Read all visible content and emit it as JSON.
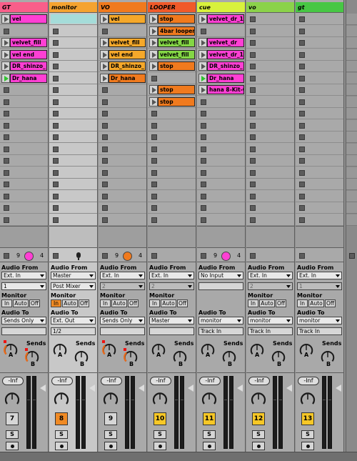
{
  "tracks": [
    {
      "id": "t1",
      "name": "GT",
      "color": "#f95e8a",
      "clips": [
        {
          "name": "vel",
          "color": "#ff3fd4"
        },
        null,
        {
          "name": "velvet_fill",
          "color": "#ff3fd4"
        },
        {
          "name": "vel end",
          "color": "#ff3fd4"
        },
        {
          "name": "DR_shinzo_",
          "color": "#ff3fd4"
        },
        {
          "name": "Dr_hana",
          "color": "#ff3fd4",
          "playing": true
        },
        null,
        null,
        null,
        null,
        null,
        null,
        null,
        null,
        null,
        null,
        null,
        null
      ],
      "counters": [
        "9",
        "4"
      ],
      "indicator": "dot",
      "indicator_color": "#ff3fd4",
      "audio_from_label": "Audio From",
      "audio_from": "Ext. In",
      "channel": "1",
      "channel_dim": false,
      "monitor_label": "Monitor",
      "monitor": [
        "In",
        "Auto",
        "Off"
      ],
      "monitor_on": null,
      "audio_to_label": "Audio To",
      "audio_to": "Sends Only",
      "audio_to_sub": "",
      "sends_label": "Sends",
      "send_a": "A",
      "send_b": "B",
      "send_red": true,
      "volume": "-Inf",
      "number": "7",
      "number_color": "#d6d6d6",
      "solo": "S",
      "selected": false
    },
    {
      "id": "t2",
      "name": "monitor",
      "color": "#f5a330",
      "clips": [
        "lane",
        null,
        null,
        null,
        null,
        null,
        null,
        null,
        null,
        null,
        null,
        null,
        null,
        null,
        null,
        null,
        null,
        null
      ],
      "counters": [
        "",
        ""
      ],
      "indicator": "mic",
      "indicator_color": "#222",
      "audio_from_label": "Audio From",
      "audio_from": "Master",
      "channel": "Post Mixer",
      "channel_dim": false,
      "monitor_label": "Monitor",
      "monitor": [
        "In",
        "Auto",
        "Off"
      ],
      "monitor_on": 0,
      "audio_to_label": "Audio To",
      "audio_to": "Ext. Out",
      "audio_to_sub": "1/2",
      "sends_label": "Sends",
      "send_a": "A",
      "send_b": "B",
      "send_red": false,
      "volume": "-Inf",
      "number": "8",
      "number_color": "#f08a24",
      "solo": "S",
      "selected": true
    },
    {
      "id": "t3",
      "name": "VO",
      "color": "#f07a1e",
      "clips": [
        {
          "name": "vel",
          "color": "#f5a82a"
        },
        null,
        {
          "name": "velvet_fill",
          "color": "#f5a82a"
        },
        {
          "name": "vel end",
          "color": "#f5a82a"
        },
        {
          "name": "DR_shinzo_",
          "color": "#f5a82a"
        },
        {
          "name": "Dr_hana",
          "color": "#f07a1e"
        },
        null,
        null,
        null,
        null,
        null,
        null,
        null,
        null,
        null,
        null,
        null,
        null
      ],
      "counters": [
        "9",
        "4"
      ],
      "indicator": "dot",
      "indicator_color": "#f07a1e",
      "audio_from_label": "Audio From",
      "audio_from": "Ext. In",
      "channel": "2",
      "channel_dim": true,
      "monitor_label": "Monitor",
      "monitor": [
        "In",
        "Auto",
        "Off"
      ],
      "monitor_on": null,
      "audio_to_label": "Audio To",
      "audio_to": "Sends Only",
      "audio_to_sub": "",
      "sends_label": "Sends",
      "send_a": "A",
      "send_b": "B",
      "send_red": true,
      "volume": "-Inf",
      "number": "9",
      "number_color": "#d6d6d6",
      "solo": "S",
      "selected": false
    },
    {
      "id": "t4",
      "name": "LOOPER",
      "color": "#f05a2a",
      "clips": [
        {
          "name": "stop",
          "color": "#f07a1e"
        },
        {
          "name": "4bar looper",
          "color": "#f07a1e"
        },
        {
          "name": "velvet_fill",
          "color": "#84d645"
        },
        {
          "name": "velvet_fill",
          "color": "#84d645"
        },
        {
          "name": "stop",
          "color": "#f07a1e"
        },
        null,
        {
          "name": "stop",
          "color": "#f07a1e"
        },
        {
          "name": "stop",
          "color": "#f07a1e"
        },
        null,
        null,
        null,
        null,
        null,
        null,
        null,
        null,
        null,
        null
      ],
      "counters": [
        "",
        ""
      ],
      "indicator": "none",
      "indicator_color": "",
      "audio_from_label": "Audio From",
      "audio_from": "Ext. In",
      "channel": "2",
      "channel_dim": true,
      "monitor_label": "Monitor",
      "monitor": [
        "In",
        "Auto",
        "Off"
      ],
      "monitor_on": null,
      "audio_to_label": "Audio To",
      "audio_to": "Master",
      "audio_to_sub": "",
      "sends_label": "Sends",
      "send_a": "A",
      "send_b": "B",
      "send_red": false,
      "volume": "-Inf",
      "number": "10",
      "number_color": "#f6c726",
      "solo": "S",
      "selected": false
    },
    {
      "id": "t5",
      "name": "cue",
      "color": "#d8f13c",
      "clips": [
        {
          "name": "velvet_dr_1",
          "color": "#ff3fd4"
        },
        null,
        {
          "name": "velvet_dr",
          "color": "#ff3fd4"
        },
        {
          "name": "velvet_dr_1",
          "color": "#ff3fd4"
        },
        {
          "name": "DR_shinzo_",
          "color": "#ff3fd4"
        },
        {
          "name": "Dr_hana",
          "color": "#ff3fd4",
          "playing": true
        },
        {
          "name": "hana 8-Kit-C",
          "color": "#ff3fd4"
        },
        null,
        null,
        null,
        null,
        null,
        null,
        null,
        null,
        null,
        null,
        null
      ],
      "counters": [
        "9",
        "4"
      ],
      "indicator": "dot",
      "indicator_color": "#ff3fd4",
      "audio_from_label": "Audio From",
      "audio_from": "No Input",
      "channel": "",
      "channel_dim": true,
      "monitor_label": "",
      "monitor": [],
      "monitor_on": null,
      "audio_to_label": "Audio To",
      "audio_to": "monitor",
      "audio_to_sub": "Track In",
      "sends_label": "Sends",
      "send_a": "A",
      "send_b": "B",
      "send_red": false,
      "volume": "-Inf",
      "number": "11",
      "number_color": "#f6c726",
      "solo": "S",
      "selected": false
    },
    {
      "id": "t6",
      "name": "vo",
      "color": "#8bd24a",
      "clips": [
        null,
        null,
        null,
        null,
        null,
        null,
        null,
        null,
        null,
        null,
        null,
        null,
        null,
        null,
        null,
        null,
        null,
        null
      ],
      "counters": [
        "",
        ""
      ],
      "indicator": "none",
      "indicator_color": "",
      "audio_from_label": "Audio From",
      "audio_from": "Ext. In",
      "channel": "2",
      "channel_dim": true,
      "monitor_label": "Monitor",
      "monitor": [
        "In",
        "Auto",
        "Off"
      ],
      "monitor_on": null,
      "audio_to_label": "Audio To",
      "audio_to": "monitor",
      "audio_to_sub": "Track In",
      "sends_label": "Sends",
      "send_a": "A",
      "send_b": "B",
      "send_red": false,
      "volume": "-Inf",
      "number": "12",
      "number_color": "#f6c726",
      "solo": "S",
      "selected": false
    },
    {
      "id": "t7",
      "name": "gt",
      "color": "#47c744",
      "clips": [
        null,
        null,
        null,
        null,
        null,
        null,
        null,
        null,
        null,
        null,
        null,
        null,
        null,
        null,
        null,
        null,
        null,
        null
      ],
      "counters": [
        "",
        ""
      ],
      "indicator": "none",
      "indicator_color": "",
      "audio_from_label": "Audio From",
      "audio_from": "Ext. In",
      "channel": "1",
      "channel_dim": true,
      "monitor_label": "Monitor",
      "monitor": [
        "In",
        "Auto",
        "Off"
      ],
      "monitor_on": null,
      "audio_to_label": "Audio To",
      "audio_to": "monitor",
      "audio_to_sub": "Track In",
      "sends_label": "Sends",
      "send_a": "A",
      "send_b": "B",
      "send_red": false,
      "volume": "-Inf",
      "number": "13",
      "number_color": "#f6c726",
      "solo": "S",
      "selected": false
    }
  ]
}
